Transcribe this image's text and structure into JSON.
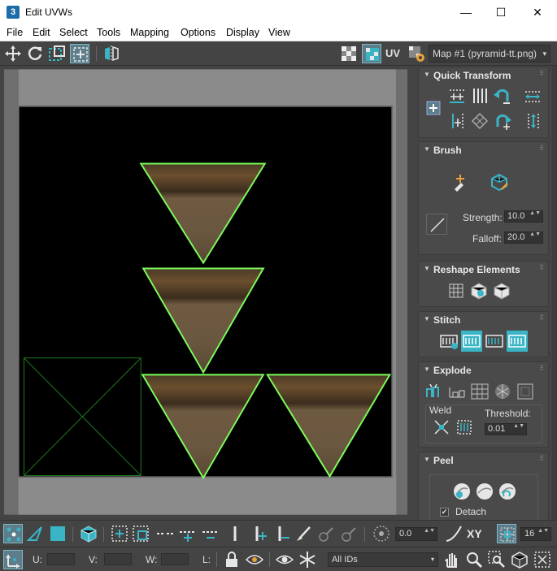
{
  "window": {
    "app_icon_glyph": "3",
    "title": "Edit UVWs",
    "minimize_glyph": "—",
    "maximize_glyph": "☐",
    "close_glyph": "✕"
  },
  "menu": [
    "File",
    "Edit",
    "Select",
    "Tools",
    "Mapping",
    "Options",
    "Display",
    "View"
  ],
  "toolbar": {
    "uv_label": "UV",
    "map_select": "Map #1 (pyramid-tt.png)",
    "dropdown_glyph": "▾"
  },
  "rollouts": {
    "quick_transform": {
      "title": "Quick Transform"
    },
    "brush": {
      "title": "Brush",
      "strength_label": "Strength:",
      "strength_value": "10.0",
      "falloff_label": "Falloff:",
      "falloff_value": "20.0"
    },
    "reshape": {
      "title": "Reshape Elements"
    },
    "stitch": {
      "title": "Stitch"
    },
    "explode": {
      "title": "Explode",
      "weld_label": "Weld",
      "threshold_label": "Threshold:",
      "threshold_value": "0.01"
    },
    "peel": {
      "title": "Peel",
      "detach_label": "Detach",
      "detach_checked": true
    }
  },
  "rollout_glyphs": {
    "expanded": "▼",
    "grip": "⠿",
    "spin": "▲▼",
    "check": "✔"
  },
  "bottom": {
    "angle_value": "0.0",
    "xy_label": "XY",
    "count_value": "16",
    "u_label": "U:",
    "v_label": "V:",
    "w_label": "W:",
    "l_label": "L:",
    "ids_select": "All IDs"
  },
  "colors": {
    "accent_teal": "#39b5c6",
    "uv_edge_green": "#7cfc5a",
    "canvas_black": "#000000",
    "viewport_gray": "#8b8b8b"
  }
}
